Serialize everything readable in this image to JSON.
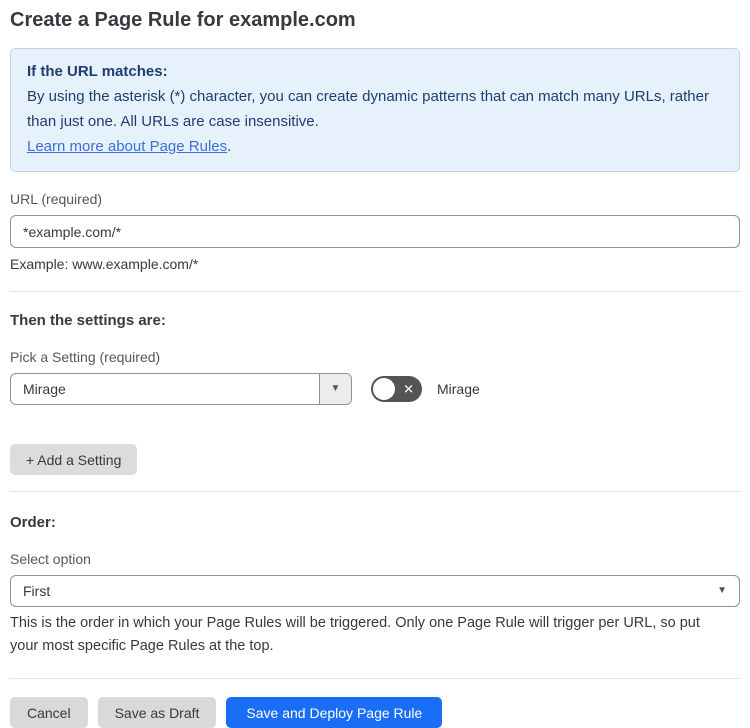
{
  "page": {
    "title": "Create a Page Rule for example.com"
  },
  "info_box": {
    "heading": "If the URL matches:",
    "body": "By using the asterisk (*) character, you can create dynamic patterns that can match many URLs, rather than just one. All URLs are case insensitive.",
    "link_text": "Learn more about Page Rules",
    "link_suffix": "."
  },
  "url_field": {
    "label": "URL (required)",
    "value": "*example.com/*",
    "helper": "Example: www.example.com/*"
  },
  "settings_section": {
    "heading": "Then the settings are:",
    "picker_label": "Pick a Setting (required)",
    "picker_value": "Mirage",
    "toggle_label": "Mirage",
    "toggle_state": "off",
    "add_button_label": "+ Add a Setting"
  },
  "order_section": {
    "heading": "Order:",
    "select_label": "Select option",
    "select_value": "First",
    "helper": "This is the order in which your Page Rules will be triggered. Only one Page Rule will trigger per URL, so put your most specific Page Rules at the top."
  },
  "footer": {
    "cancel_label": "Cancel",
    "save_draft_label": "Save as Draft",
    "save_deploy_label": "Save and Deploy Page Rule"
  },
  "icons": {
    "picker_caret": "▼",
    "select_caret": "▼",
    "toggle_x": "✕"
  },
  "colors": {
    "accent_blue": "#1a6ef5",
    "info_background": "#e7f1fc",
    "info_border": "#b9d6f2",
    "info_text": "#1f3d71",
    "link_blue": "#3b6fd9",
    "toggle_off_background": "#545454",
    "gray_button_background": "#d9d9d9",
    "text_dark": "#36393f",
    "label_gray": "#56565c"
  }
}
